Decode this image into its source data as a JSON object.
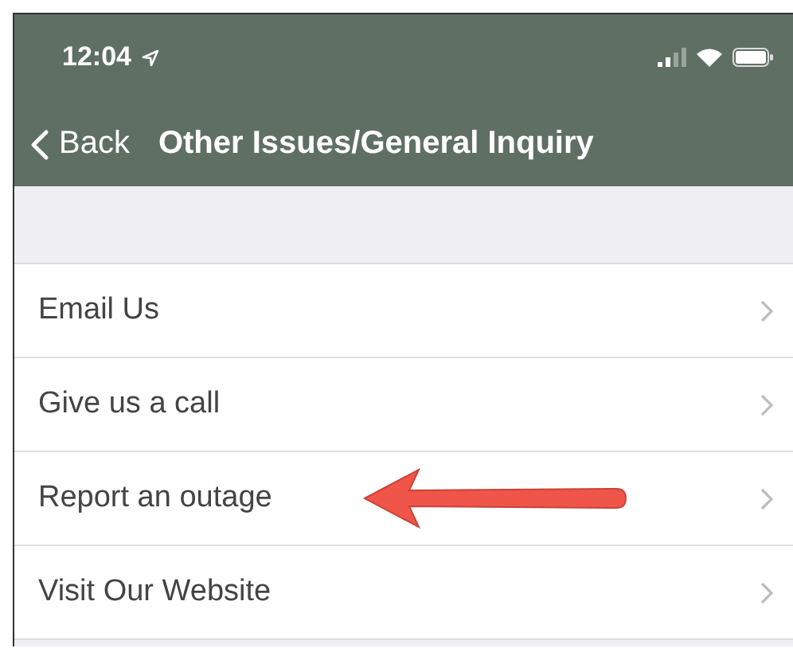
{
  "status_bar": {
    "time": "12:04"
  },
  "nav": {
    "back": "Back",
    "title": "Other Issues/General Inquiry"
  },
  "menu": [
    {
      "label": "Email Us",
      "annotated": false
    },
    {
      "label": "Give us a call",
      "annotated": false
    },
    {
      "label": "Report an outage",
      "annotated": true
    },
    {
      "label": "Visit Our Website",
      "annotated": false
    }
  ]
}
